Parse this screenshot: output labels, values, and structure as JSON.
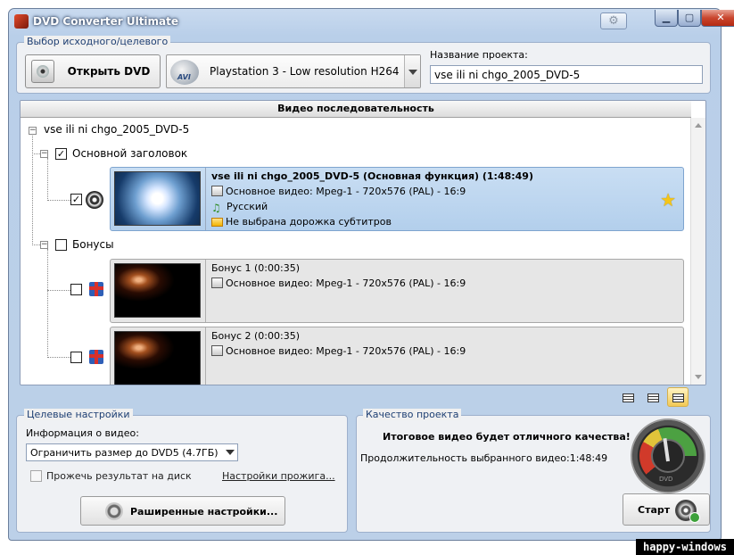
{
  "window": {
    "title": "DVD Converter Ultimate"
  },
  "source_group": {
    "title": "Выбор исходного/целевого",
    "open_button": "Открыть DVD",
    "profile": "Playstation 3 - Low resolution H264",
    "project_label": "Название проекта:",
    "project_value": "vse ili ni chgo_2005_DVD-5"
  },
  "sequence": {
    "header": "Видео последовательность",
    "root": "vse ili ni chgo_2005_DVD-5",
    "main_title_group": "Основной заголовок",
    "main_item": {
      "title": "vse ili ni chgo_2005_DVD-5 (Основная функция) (1:48:49)",
      "video": "Основное видео: Mpeg-1 - 720x576 (PAL) - 16:9",
      "audio": "Русский",
      "subtitles": "Не выбрана дорожка субтитров"
    },
    "bonus_group": "Бонусы",
    "bonuses": [
      {
        "title": "Бонус 1 (0:00:35)",
        "video": "Основное видео: Mpeg-1 - 720x576 (PAL) - 16:9"
      },
      {
        "title": "Бонус 2 (0:00:35)",
        "video": "Основное видео: Mpeg-1 - 720x576 (PAL) - 16:9"
      }
    ]
  },
  "target_group": {
    "title": "Целевые настройки",
    "info_label": "Информация о видео:",
    "size_option": "Ограничить размер до DVD5 (4.7ГБ)",
    "burn_label": "Прожечь результат на диск",
    "burn_settings": "Настройки прожига...",
    "advanced_button": "Раширенные настройки..."
  },
  "quality_group": {
    "title": "Качество проекта",
    "message": "Итоговое видео будет отличного качества!",
    "duration": "Продолжительность выбранного видео:1:48:49",
    "gauge_label": "DVD",
    "start_button": "Старт"
  },
  "watermark": "happy-windows"
}
